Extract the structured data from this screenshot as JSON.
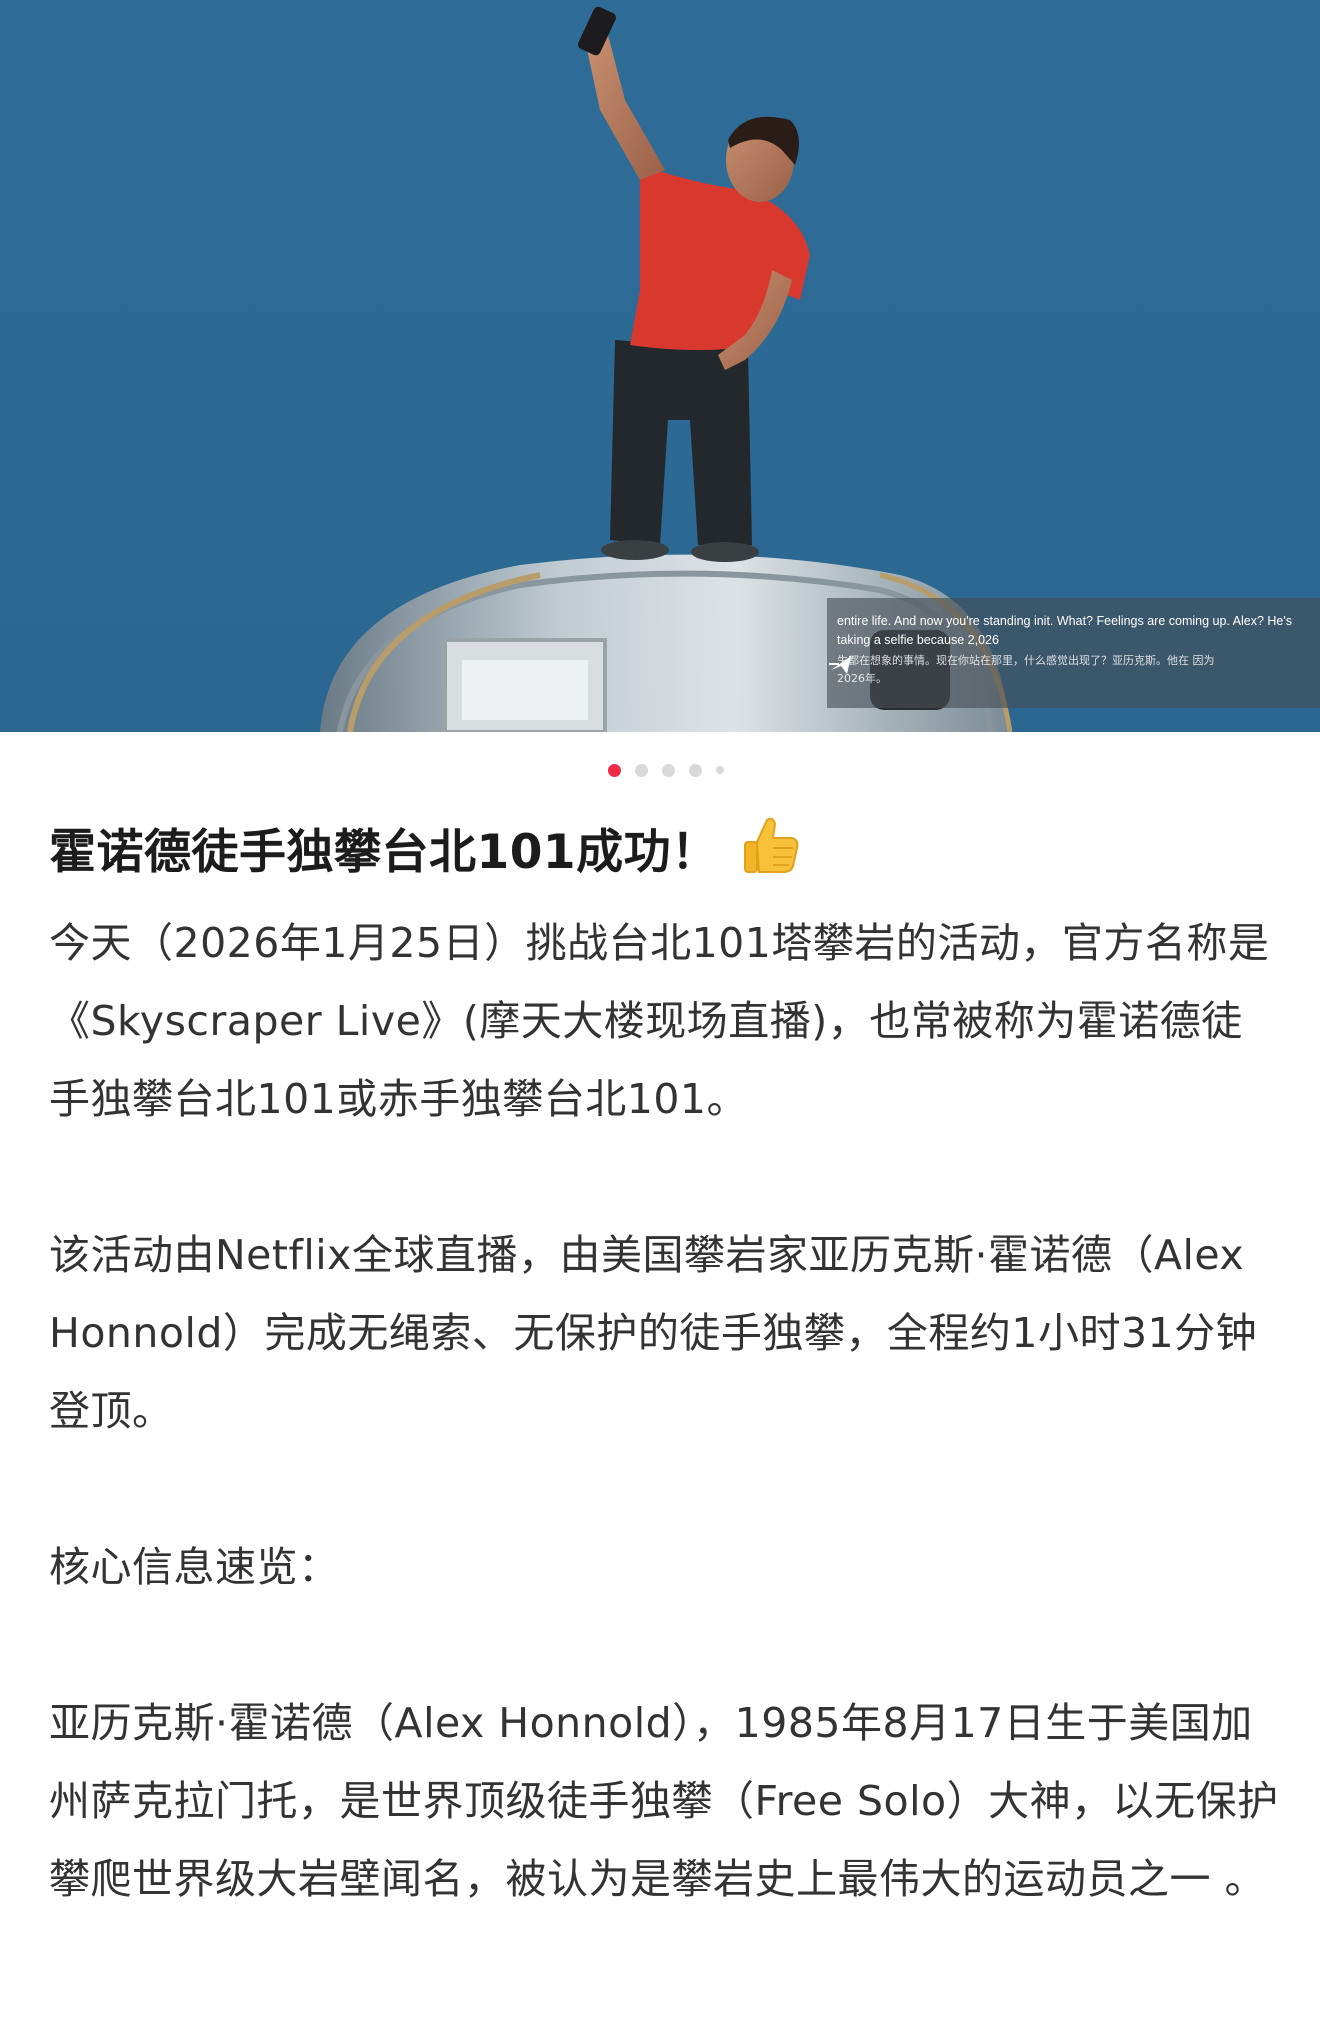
{
  "hero": {
    "subtitle_en": "entire life. And now you're standing init. What? Feelings are coming up. Alex? He's taking a selfie because 2,026",
    "subtitle_zh": "生都在想象的事情。现在你站在那里，什么感觉出现了？亚历克斯。他在 因为 2026年。",
    "translate_icon": "translate-icon"
  },
  "carousel": {
    "total": 5,
    "active_index": 0,
    "active_color": "#ef2b47",
    "inactive_color": "#d9d9d9"
  },
  "post": {
    "title": "霍诺德徒手独攀台北101成功！",
    "title_emoji": "thumbs-up-icon",
    "paragraphs": [
      "今天（2026年1月25日）挑战台北101塔攀岩的活动，官方名称是《Skyscraper Live》(摩天大楼现场直播)，也常被称为霍诺德徒手独攀台北101或赤手独攀台北101。",
      "该活动由Netflix全球直播，由美国攀岩家亚历克斯·霍诺德（Alex Honnold）完成无绳索、无保护的徒手独攀，全程约1小时31分钟登顶。",
      "核心信息速览：",
      "亚历克斯·霍诺德（Alex Honnold），1985年8月17日生于美国加州萨克拉门托，是世界顶级徒手独攀（Free Solo）大神，以无保护攀爬世界级大岩壁闻名，被认为是攀岩史上最伟大的运动员之一 。"
    ]
  }
}
